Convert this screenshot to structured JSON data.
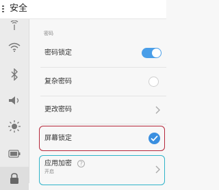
{
  "header": {
    "title": "安全"
  },
  "sidebar": {
    "items": [
      {
        "icon": "antenna-icon"
      },
      {
        "icon": "wifi-icon"
      },
      {
        "icon": "bluetooth-icon"
      },
      {
        "icon": "volume-icon"
      },
      {
        "icon": "brightness-icon"
      },
      {
        "icon": "battery-icon"
      },
      {
        "icon": "lock-icon"
      }
    ]
  },
  "section": {
    "header": "密码"
  },
  "settings": [
    {
      "label": "密码锁定",
      "control": "toggle",
      "state": "on"
    },
    {
      "label": "复杂密码",
      "control": "radio",
      "state": "off"
    },
    {
      "label": "更改密码",
      "control": "chevron"
    },
    {
      "label": "屏幕锁定",
      "control": "check",
      "state": "checked"
    },
    {
      "label": "应用加密",
      "sublabel": "开启",
      "control": "chevron",
      "help_glyph": "?"
    }
  ],
  "colors": {
    "accent": "#4a9ee8",
    "highlight_red": "#b5273a",
    "highlight_blue": "#2fb3c9"
  }
}
